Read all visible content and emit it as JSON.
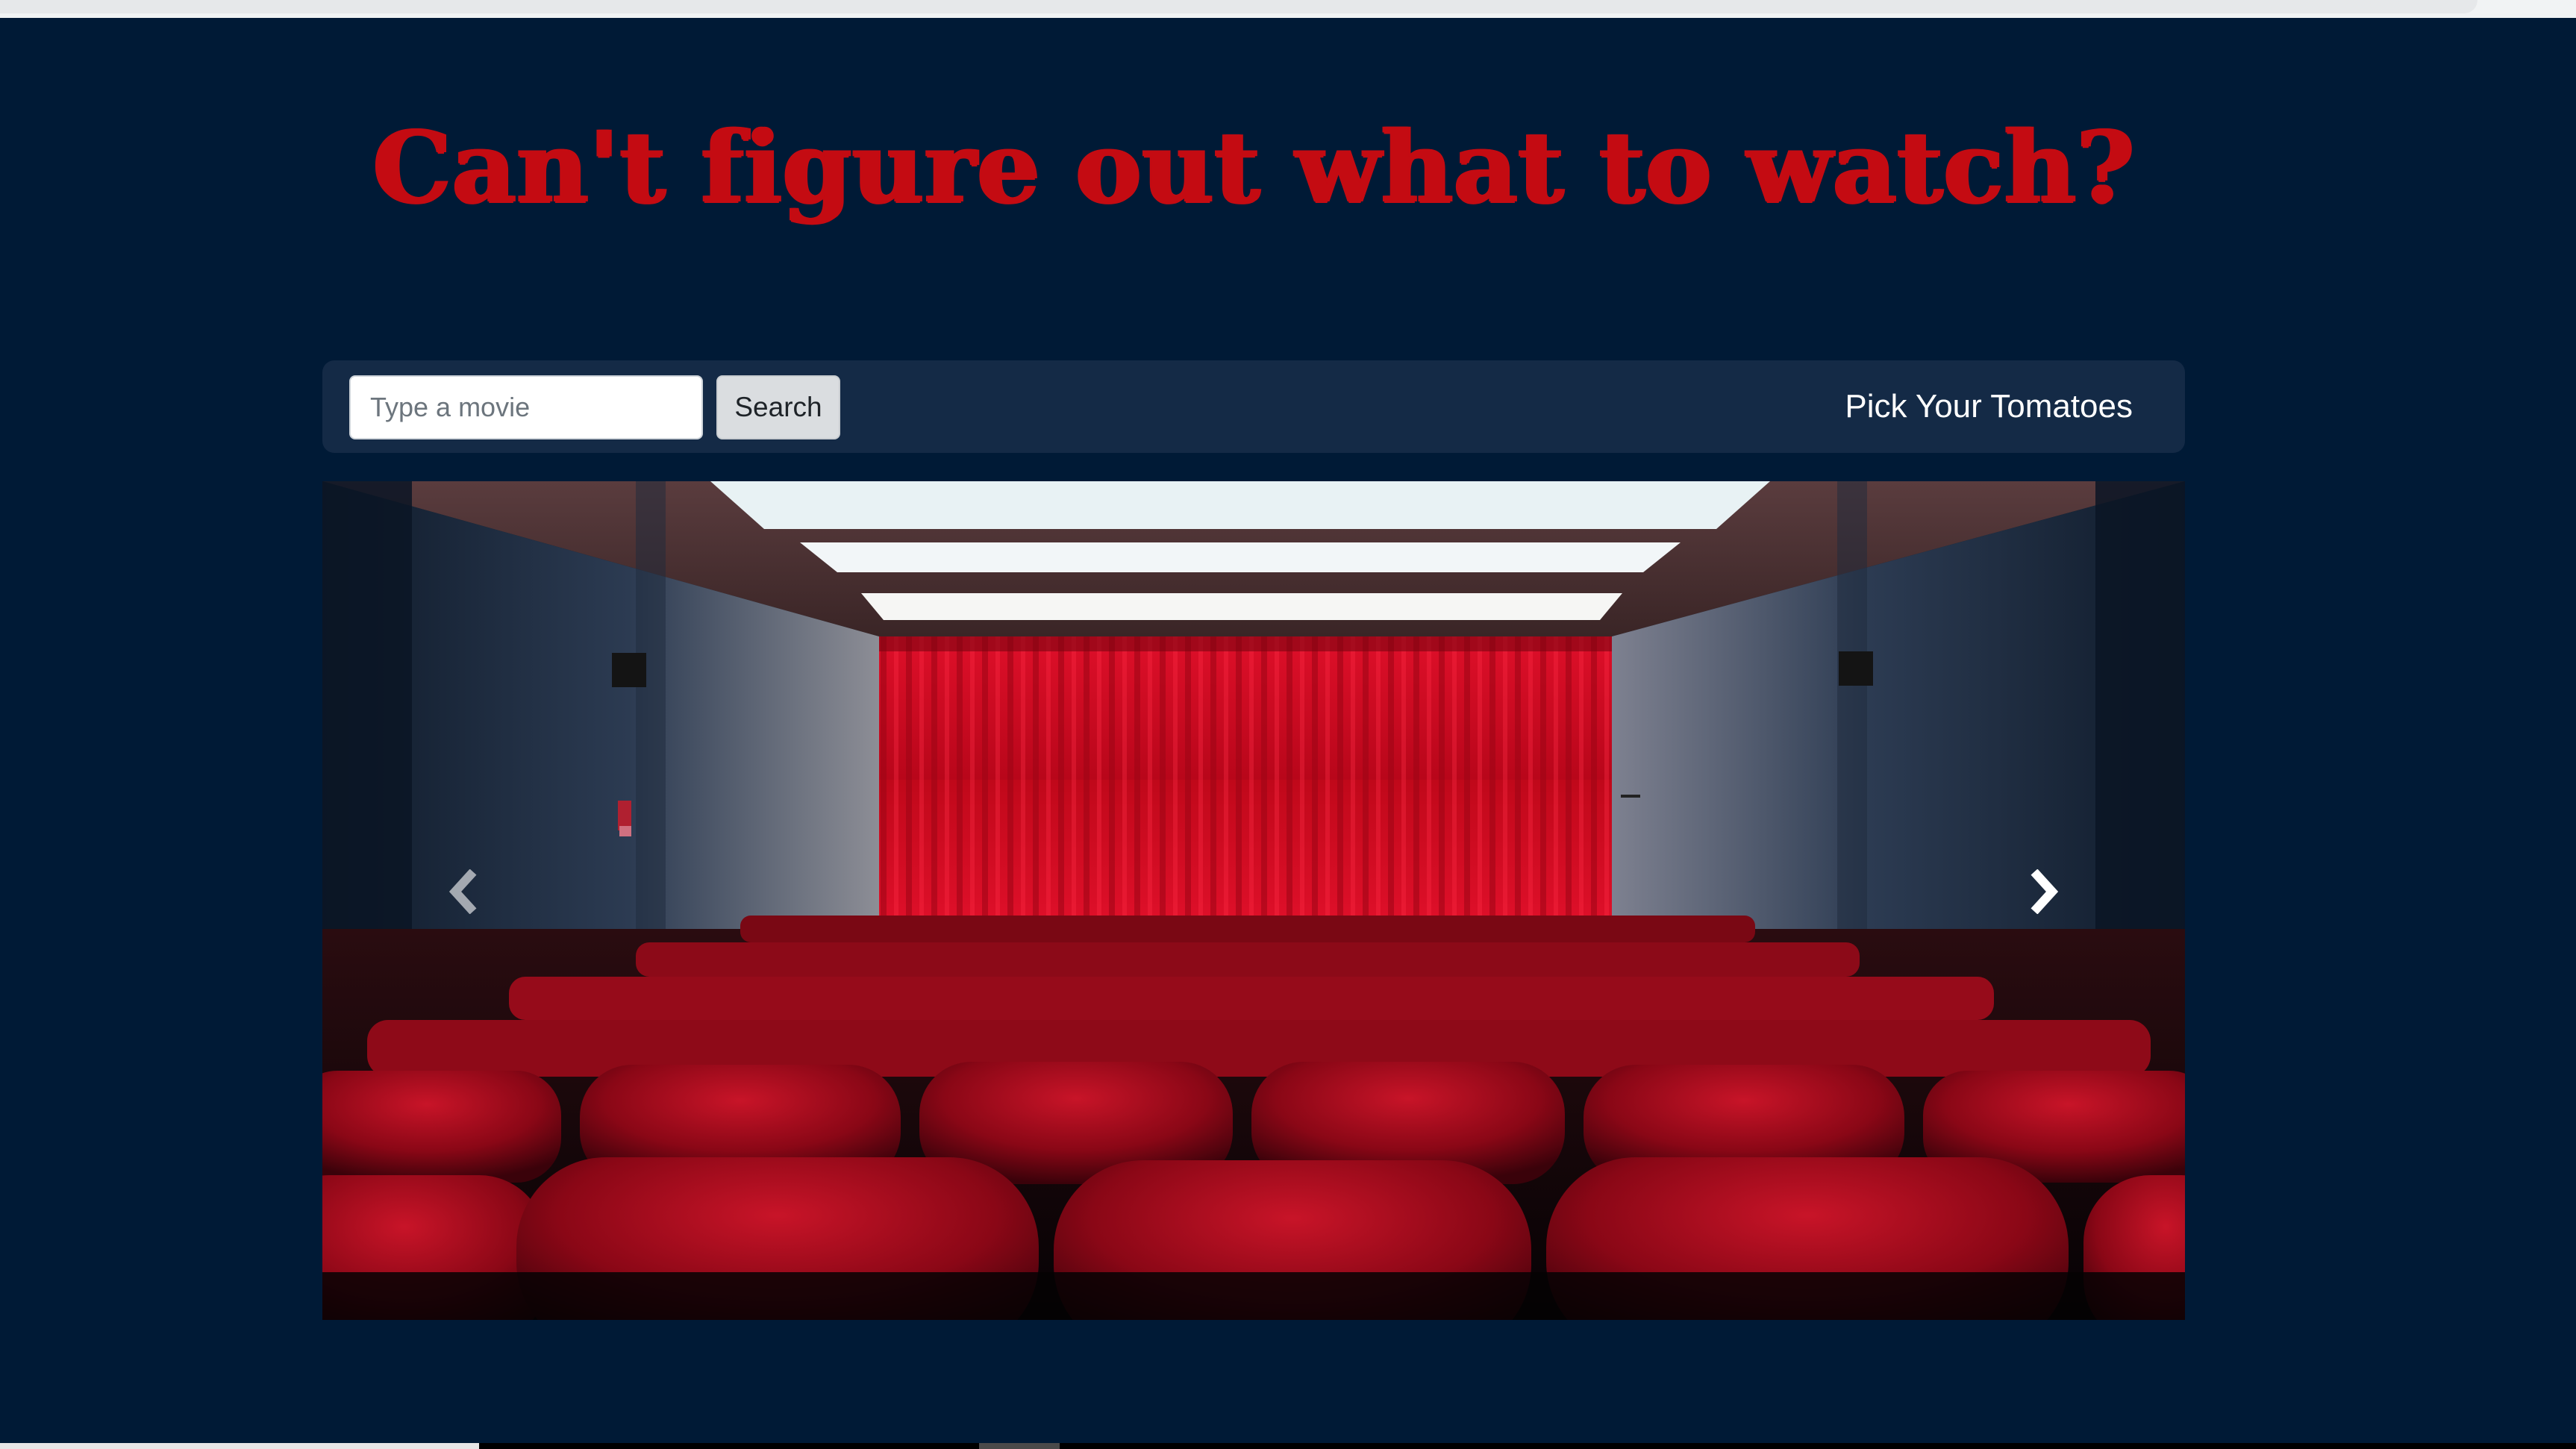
{
  "hero": {
    "headline": "Can't figure out what to watch?"
  },
  "navbar": {
    "search_placeholder": "Type a movie",
    "search_value": "",
    "search_button": "Search",
    "brand": "Pick Your Tomatoes"
  },
  "carousel": {
    "slide_image": "movie theater with red curtain and red seats",
    "prev_icon": "chevron-left-icon",
    "next_icon": "chevron-right-icon"
  },
  "colors": {
    "background": "#001a36",
    "headline": "#c40b12",
    "navbar": "#142a46",
    "brand_text": "#ffffff"
  }
}
